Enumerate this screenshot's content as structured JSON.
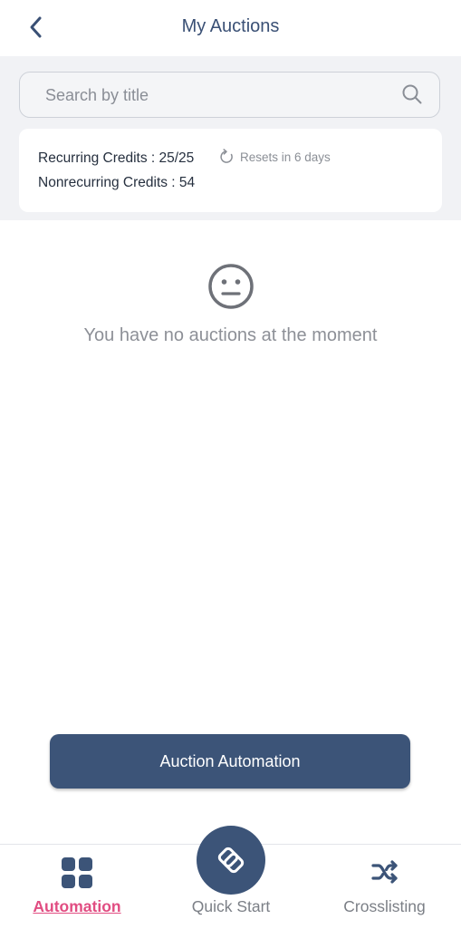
{
  "header": {
    "title": "My Auctions"
  },
  "search": {
    "placeholder": "Search by title"
  },
  "credits": {
    "recurring": "Recurring Credits : 25/25",
    "nonrecurring": "Nonrecurring Credits : 54",
    "reset_text": "Resets in 6 days"
  },
  "empty_state": {
    "message": "You have no auctions at the moment"
  },
  "cta": {
    "label": "Auction Automation"
  },
  "bottom_nav": {
    "items": [
      {
        "label": "Automation",
        "icon": "grid-icon",
        "active": true
      },
      {
        "label": "Quick Start",
        "icon": "quick-start-icon",
        "active": false
      },
      {
        "label": "Crosslisting",
        "icon": "shuffle-icon",
        "active": false
      }
    ]
  },
  "colors": {
    "primary": "#3c5478",
    "accent": "#e14d82",
    "panel_bg": "#f1f2f5"
  }
}
